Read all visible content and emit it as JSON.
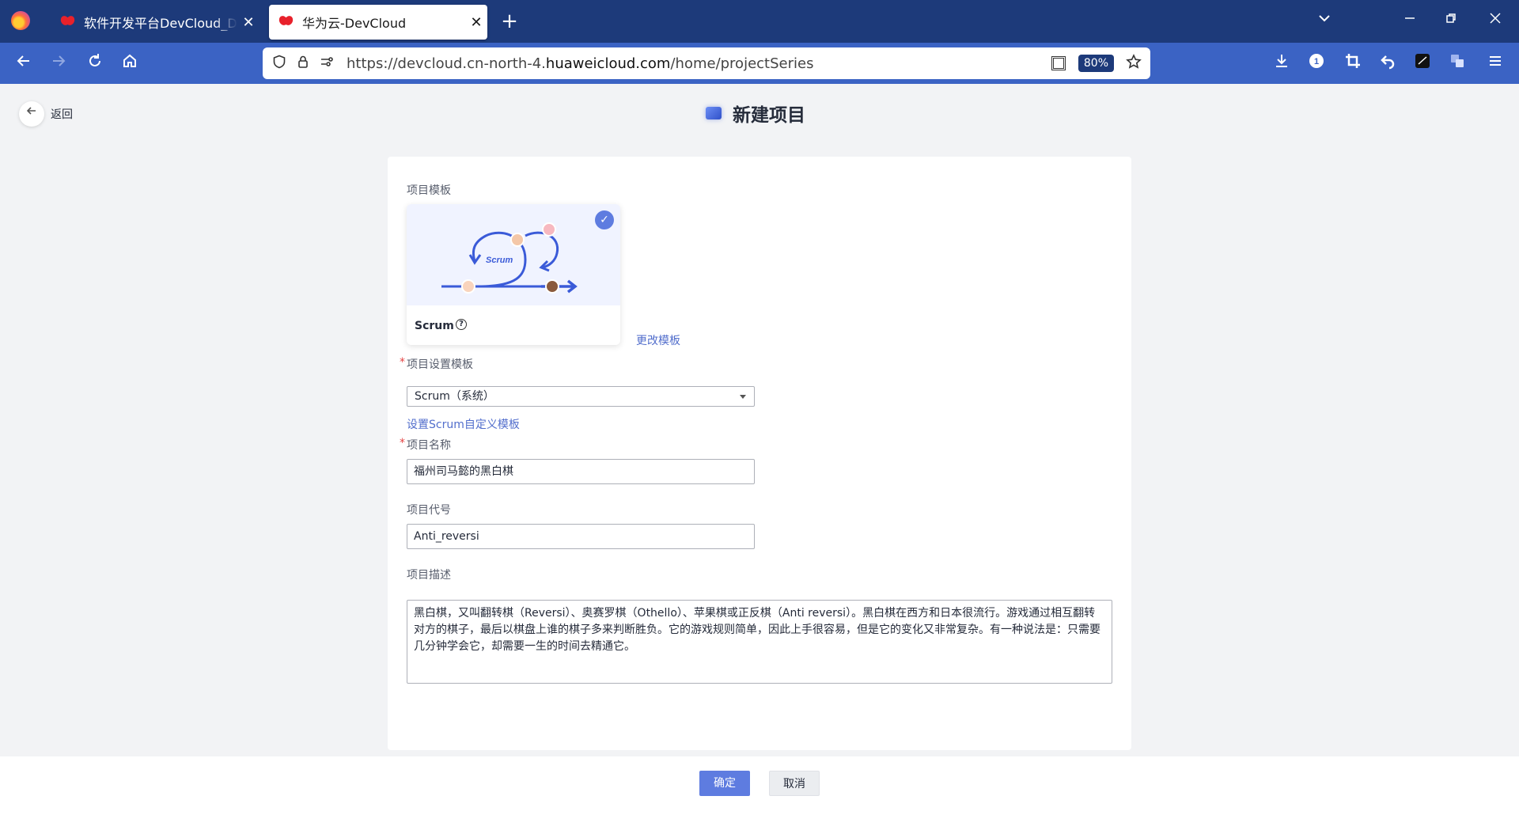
{
  "browser": {
    "tabs": [
      {
        "title": "软件开发平台DevCloud_DevOps",
        "active": false
      },
      {
        "title": "华为云-DevCloud",
        "active": true
      }
    ],
    "url_prefix": "https://devcloud.cn-north-4.",
    "url_domain": "huaweicloud.com",
    "url_path": "/home/projectSeries",
    "zoom": "80%",
    "tab_close": "✕",
    "new_tab": "+"
  },
  "header": {
    "back_label": "返回",
    "title": "新建项目"
  },
  "form": {
    "template_label": "项目模板",
    "template_card": {
      "name": "Scrum",
      "illustration_text": "Scrum",
      "selected": true
    },
    "change_template_link": "更改模板",
    "settings_label": "项目设置模板",
    "settings_value": "Scrum（系统）",
    "custom_template_link": "设置Scrum自定义模板",
    "name_label": "项目名称",
    "name_value": "福州司马懿的黑白棋",
    "code_label": "项目代号",
    "code_value": "Anti_reversi",
    "desc_label": "项目描述",
    "desc_value": "黑白棋，又叫翻转棋（Reversi）、奥赛罗棋（Othello）、苹果棋或正反棋（Anti reversi）。黑白棋在西方和日本很流行。游戏通过相互翻转对方的棋子，最后以棋盘上谁的棋子多来判断胜负。它的游戏规则简单，因此上手很容易，但是它的变化又非常复杂。有一种说法是：只需要几分钟学会它，却需要一生的时间去精通它。",
    "required_mark": "*"
  },
  "footer": {
    "confirm_label": "确定",
    "cancel_label": "取消"
  },
  "colors": {
    "primary": "#5e7ce0",
    "link": "#526ecc",
    "tabbar": "#1d3a7a",
    "navbar": "#3b63c4"
  }
}
